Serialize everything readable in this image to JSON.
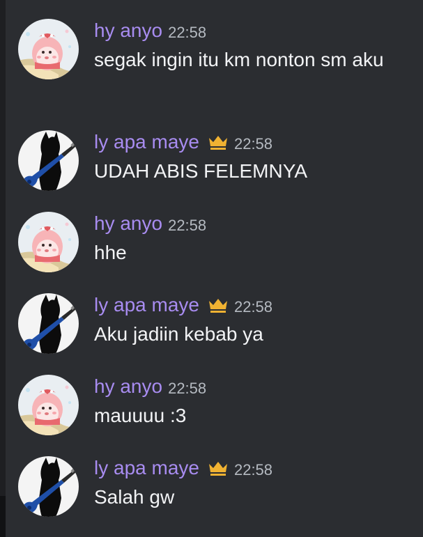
{
  "messages": [
    {
      "author": "hy anyo",
      "avatar": "strawberry-character-avatar",
      "has_crown": false,
      "time": "22:58",
      "text": "segak ingin itu km nonton sm aku"
    },
    {
      "author": "ly apa maye",
      "avatar": "black-cat-guitar-avatar",
      "has_crown": true,
      "time": "22:58",
      "text": "UDAH ABIS FELEMNYA"
    },
    {
      "author": "hy anyo",
      "avatar": "strawberry-character-avatar",
      "has_crown": false,
      "time": "22:58",
      "text": "hhe"
    },
    {
      "author": "ly apa maye",
      "avatar": "black-cat-guitar-avatar",
      "has_crown": true,
      "time": "22:58",
      "text": "Aku jadiin kebab ya"
    },
    {
      "author": "hy anyo",
      "avatar": "strawberry-character-avatar",
      "has_crown": false,
      "time": "22:58",
      "text": "mauuuu :3"
    },
    {
      "author": "ly apa maye",
      "avatar": "black-cat-guitar-avatar",
      "has_crown": true,
      "time": "22:58",
      "text": "Salah gw"
    }
  ],
  "colors": {
    "background": "#2b2d31",
    "username": "#a88cf0",
    "timestamp": "#b5bac1",
    "message_text": "#f2f3f5",
    "crown": "#f0b232"
  }
}
